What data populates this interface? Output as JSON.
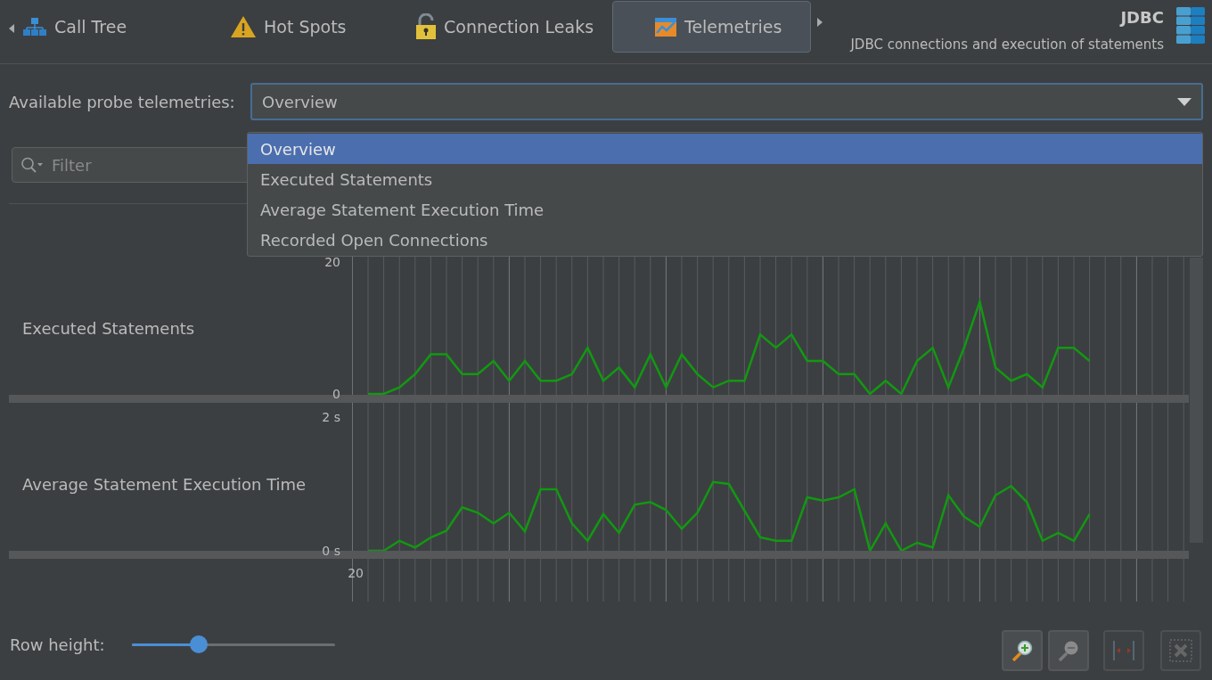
{
  "tabs": [
    {
      "label": "Call Tree",
      "selected": false
    },
    {
      "label": "Hot Spots",
      "selected": false
    },
    {
      "label": "Connection Leaks",
      "selected": false
    },
    {
      "label": "Telemetries",
      "selected": true
    }
  ],
  "header": {
    "title": "JDBC",
    "subtitle": "JDBC connections and execution of statements"
  },
  "probe_select": {
    "label": "Available probe telemetries:",
    "value": "Overview",
    "expanded": true,
    "options": [
      {
        "label": "Overview",
        "selected": true
      },
      {
        "label": "Executed Statements",
        "selected": false
      },
      {
        "label": "Average Statement Execution Time",
        "selected": false
      },
      {
        "label": "Recorded Open Connections",
        "selected": false
      }
    ]
  },
  "filter": {
    "placeholder": "Filter"
  },
  "charts": [
    {
      "label": "Executed Statements",
      "chart_data": {
        "type": "line",
        "grid": true,
        "ylim": [
          0,
          20
        ],
        "yticks": [
          {
            "value": 0,
            "label": "0"
          },
          {
            "value": 20,
            "label": "20"
          }
        ],
        "series": [
          {
            "color": "#119911",
            "values": [
              0,
              0,
              1,
              3,
              6,
              6,
              3,
              3,
              5,
              2,
              5,
              2,
              2,
              3,
              7,
              2,
              4,
              1,
              6,
              1,
              6,
              3,
              1,
              2,
              2,
              9,
              7,
              9,
              5,
              5,
              3,
              3,
              0,
              2,
              0,
              5,
              7,
              1,
              7,
              14,
              4,
              2,
              3,
              1,
              7,
              7,
              5
            ]
          }
        ]
      }
    },
    {
      "label": "Average Statement Execution Time",
      "chart_data": {
        "type": "line",
        "grid": true,
        "ylim": [
          0,
          2
        ],
        "yticks": [
          {
            "value": 0,
            "label": "0 s"
          },
          {
            "value": 2,
            "label": "2 s"
          }
        ],
        "series": [
          {
            "color": "#119911",
            "values": [
              0,
              0,
              0.15,
              0.05,
              0.2,
              0.3,
              0.65,
              0.57,
              0.41,
              0.57,
              0.29,
              0.92,
              0.92,
              0.41,
              0.15,
              0.55,
              0.27,
              0.69,
              0.73,
              0.61,
              0.33,
              0.57,
              1.03,
              1.0,
              0.6,
              0.2,
              0.15,
              0.15,
              0.8,
              0.75,
              0.8,
              0.92,
              0,
              0.41,
              0,
              0.12,
              0.05,
              0.83,
              0.51,
              0.36,
              0.83,
              0.97,
              0.73,
              0.15,
              0.27,
              0.15,
              0.55
            ]
          }
        ]
      }
    },
    {
      "kind": "partial",
      "tick_label": "20"
    }
  ],
  "row_height": {
    "label": "Row height:",
    "level": 0.33
  },
  "tools": [
    {
      "kind": "zoom-in",
      "disabled": false
    },
    {
      "kind": "zoom-out",
      "disabled": false
    },
    {
      "kind": "fit",
      "disabled": true
    },
    {
      "kind": "clear",
      "disabled": true
    }
  ]
}
